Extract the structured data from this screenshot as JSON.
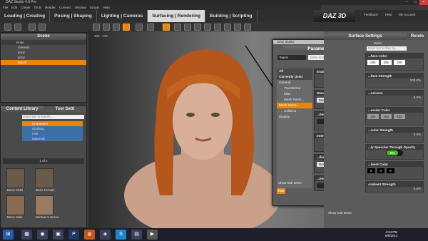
{
  "window": {
    "title": "DAZ Studio 4.6 Pro"
  },
  "menu": [
    "File",
    "Edit",
    "Create",
    "Tools",
    "Render",
    "Connect",
    "Window",
    "Scripts",
    "Help"
  ],
  "tabs": [
    {
      "label": "Loading | Creating",
      "active": false
    },
    {
      "label": "Posing | Shaping",
      "active": false
    },
    {
      "label": "Lighting | Cameras",
      "active": false
    },
    {
      "label": "Surfacing | Rendering",
      "active": true
    },
    {
      "label": "Building | Scripting",
      "active": false
    }
  ],
  "logo": "DAZ 3D",
  "toplinks": {
    "feedback": "Feedback",
    "help": "Help",
    "account": "My Account"
  },
  "scene": {
    "title": "Scene",
    "column": "Node",
    "nodes": [
      {
        "label": "Genesis"
      },
      {
        "label": "pony"
      },
      {
        "label": "pony"
      },
      {
        "label": "beyon",
        "selected": true
      }
    ]
  },
  "content_library": {
    "tab1": "Content Library",
    "tab2": "Tool Setti",
    "filter_placeholder": "Enter text to search...",
    "folders": [
      "Characters",
      "Clothing",
      "Hair",
      "Materials"
    ],
    "page": "1 of 4",
    "thumbs": [
      "Basic Child",
      "Basic Female",
      "Basic Male",
      "Michael 5 Heroic"
    ],
    "badge": "ACTIVE"
  },
  "viewport": {
    "label": "Perspective View",
    "coord": "202 : 175"
  },
  "parameters": {
    "window_title": "DAZ Studio",
    "title": "Parameters",
    "node": "beyon",
    "filter_placeholder": "Enter text to filter by...",
    "tree": [
      {
        "label": "All",
        "type": "cat"
      },
      {
        "label": "Currently Used",
        "type": "cat"
      },
      {
        "label": "General",
        "type": "item"
      },
      {
        "label": "Transforms",
        "type": "sub"
      },
      {
        "label": "Misc",
        "type": "sub"
      },
      {
        "label": "Mesh Resol...",
        "type": "sub"
      },
      {
        "label": "Mesh Smoo...",
        "type": "sel"
      },
      {
        "label": "Collision",
        "type": "sub"
      },
      {
        "label": "Display",
        "type": "item"
      }
    ],
    "cards": [
      {
        "label": "Enable Smoothing",
        "kind": "toggle",
        "value": "On"
      },
      {
        "label": "Smoothing Type",
        "kind": "dropdown",
        "value": "Base Shape Matching"
      },
      {
        "label": "...Iterations",
        "kind": "slider",
        "value": ""
      },
      {
        "label": "Interactive Update",
        "kind": "toggle",
        "value": "On"
      },
      {
        "label": "...llision Item",
        "kind": "dropdown",
        "value": "Genesis..."
      },
      {
        "label": "...Iterations",
        "kind": "slider",
        "value": ""
      }
    ],
    "show_sub": "Show Sub Items",
    "tips": "Tips"
  },
  "surfaces": {
    "title": "Surface Settings",
    "tab2": "Rende",
    "baker": "Baker",
    "filter_placeholder": "Enter text to filter by...",
    "cards": [
      {
        "label": "...fuse Color",
        "r": "255",
        "g": "255",
        "b": "255"
      },
      {
        "label": "...fuse Strength",
        "pct": "100.0%"
      },
      {
        "label": "...ssiness",
        "pct": "0.0%"
      },
      {
        "label": "...ecular Color",
        "r": "153",
        "g": "153",
        "b": "153"
      },
      {
        "label": "...cular Strength",
        "pct": "0.0%"
      },
      {
        "label": "...ly Specular Through Opacity",
        "toggle": "On"
      },
      {
        "label": "...bient Color",
        "r": "0",
        "g": "0",
        "b": "0"
      },
      {
        "label": "Ambient Strength",
        "pct": "0.0%"
      }
    ],
    "show_sub": "Show Sub Items"
  },
  "taskbar": {
    "time": "4:24 PM",
    "date": "6/9/2014"
  },
  "colors": {
    "accent": "#e8860c",
    "toggle_on": "#3fbf24"
  }
}
